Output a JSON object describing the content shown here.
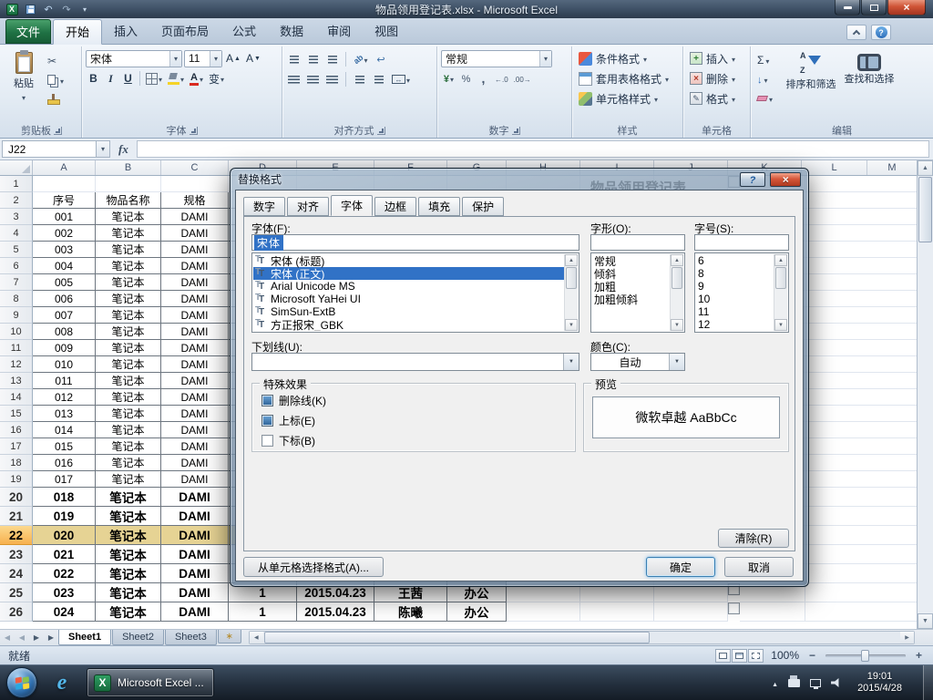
{
  "window": {
    "title": "物品领用登记表.xlsx - Microsoft Excel"
  },
  "ribbon": {
    "file_tab": "文件",
    "tabs": [
      {
        "label": "开始",
        "active": true
      },
      {
        "label": "插入"
      },
      {
        "label": "页面布局"
      },
      {
        "label": "公式"
      },
      {
        "label": "数据"
      },
      {
        "label": "审阅"
      },
      {
        "label": "视图"
      }
    ],
    "clipboard": {
      "label": "剪贴板",
      "paste": "粘贴"
    },
    "font": {
      "label": "字体",
      "name": "宋体",
      "size": "11",
      "bold": "B",
      "italic": "I",
      "underline": "U",
      "phonetic": "变"
    },
    "alignment": {
      "label": "对齐方式"
    },
    "number": {
      "label": "数字",
      "format": "常规"
    },
    "styles": {
      "label": "样式",
      "items": [
        "条件格式",
        "套用表格格式",
        "单元格样式"
      ]
    },
    "cells": {
      "label": "单元格",
      "items": [
        "插入",
        "删除",
        "格式"
      ]
    },
    "editing": {
      "label": "编辑",
      "sort": "排序和筛选",
      "find": "查找和选择"
    }
  },
  "formula_bar": {
    "name_box": "J22",
    "fx": "fx",
    "value": ""
  },
  "grid": {
    "title": "物品领用登记表",
    "columns": [
      "A",
      "B",
      "C",
      "D",
      "E",
      "F",
      "G",
      "H",
      "I",
      "J",
      "K",
      "L",
      "M"
    ],
    "rows": [
      {
        "num": "1",
        "plain": true
      },
      {
        "num": "2",
        "a": "序号",
        "b": "物品名称",
        "c": "规格"
      },
      {
        "num": "3",
        "a": "001",
        "b": "笔记本",
        "c": "DAMI"
      },
      {
        "num": "4",
        "a": "002",
        "b": "笔记本",
        "c": "DAMI"
      },
      {
        "num": "5",
        "a": "003",
        "b": "笔记本",
        "c": "DAMI"
      },
      {
        "num": "6",
        "a": "004",
        "b": "笔记本",
        "c": "DAMI"
      },
      {
        "num": "7",
        "a": "005",
        "b": "笔记本",
        "c": "DAMI"
      },
      {
        "num": "8",
        "a": "006",
        "b": "笔记本",
        "c": "DAMI"
      },
      {
        "num": "9",
        "a": "007",
        "b": "笔记本",
        "c": "DAMI"
      },
      {
        "num": "10",
        "a": "008",
        "b": "笔记本",
        "c": "DAMI"
      },
      {
        "num": "11",
        "a": "009",
        "b": "笔记本",
        "c": "DAMI"
      },
      {
        "num": "12",
        "a": "010",
        "b": "笔记本",
        "c": "DAMI"
      },
      {
        "num": "13",
        "a": "011",
        "b": "笔记本",
        "c": "DAMI"
      },
      {
        "num": "14",
        "a": "012",
        "b": "笔记本",
        "c": "DAMI"
      },
      {
        "num": "15",
        "a": "013",
        "b": "笔记本",
        "c": "DAMI"
      },
      {
        "num": "16",
        "a": "014",
        "b": "笔记本",
        "c": "DAMI"
      },
      {
        "num": "17",
        "a": "015",
        "b": "笔记本",
        "c": "DAMI"
      },
      {
        "num": "18",
        "a": "016",
        "b": "笔记本",
        "c": "DAMI"
      },
      {
        "num": "19",
        "a": "017",
        "b": "笔记本",
        "c": "DAMI"
      },
      {
        "num": "20",
        "a": "018",
        "b": "笔记本",
        "c": "DAMI",
        "bold": true
      },
      {
        "num": "21",
        "a": "019",
        "b": "笔记本",
        "c": "DAMI",
        "bold": true
      },
      {
        "num": "22",
        "a": "020",
        "b": "笔记本",
        "c": "DAMI",
        "bold": true,
        "hl": true
      },
      {
        "num": "23",
        "a": "021",
        "b": "笔记本",
        "c": "DAMI",
        "bold": true
      },
      {
        "num": "24",
        "a": "022",
        "b": "笔记本",
        "c": "DAMI",
        "bold": true
      },
      {
        "num": "25",
        "a": "023",
        "b": "笔记本",
        "c": "DAMI",
        "d": "1",
        "e": "2015.04.23",
        "f": "王茜",
        "g": "办公",
        "bold": true
      },
      {
        "num": "26",
        "a": "024",
        "b": "笔记本",
        "c": "DAMI",
        "d": "1",
        "e": "2015.04.23",
        "f": "陈曦",
        "g": "办公",
        "bold": true
      }
    ]
  },
  "sheet_bar": {
    "tabs": [
      {
        "label": "Sheet1",
        "active": true
      },
      {
        "label": "Sheet2"
      },
      {
        "label": "Sheet3"
      }
    ]
  },
  "status_bar": {
    "ready": "就绪",
    "zoom": "100%"
  },
  "taskbar": {
    "excel_button": "Microsoft Excel ...",
    "time": "19:01",
    "date": "2015/4/28"
  },
  "dialog": {
    "title": "替换格式",
    "tabs": [
      {
        "label": "数字"
      },
      {
        "label": "对齐"
      },
      {
        "label": "字体",
        "active": true
      },
      {
        "label": "边框"
      },
      {
        "label": "填充"
      },
      {
        "label": "保护"
      }
    ],
    "font": {
      "label": "字体(F):",
      "value": "宋体",
      "list": [
        {
          "name": "宋体 (标题)"
        },
        {
          "name": "宋体 (正文)",
          "selected": true
        },
        {
          "name": "Arial Unicode MS"
        },
        {
          "name": "Microsoft YaHei UI"
        },
        {
          "name": "SimSun-ExtB"
        },
        {
          "name": "方正报宋_GBK"
        }
      ]
    },
    "style": {
      "label": "字形(O):",
      "list": [
        {
          "name": "常规"
        },
        {
          "name": "倾斜"
        },
        {
          "name": "加粗"
        },
        {
          "name": "加粗倾斜"
        }
      ]
    },
    "size": {
      "label": "字号(S):",
      "list": [
        {
          "name": "6"
        },
        {
          "name": "8"
        },
        {
          "name": "9"
        },
        {
          "name": "10"
        },
        {
          "name": "11"
        },
        {
          "name": "12"
        }
      ]
    },
    "underline": {
      "label": "下划线(U):",
      "value": ""
    },
    "color": {
      "label": "颜色(C):",
      "value": "自动"
    },
    "effects": {
      "label": "特殊效果",
      "items": [
        {
          "label": "删除线(K)",
          "filled": true
        },
        {
          "label": "上标(E)",
          "filled": true
        },
        {
          "label": "下标(B)",
          "filled": false
        }
      ]
    },
    "preview": {
      "label": "预览",
      "text": "微软卓越  AaBbCc"
    },
    "buttons": {
      "clear": "清除(R)",
      "choose": "从单元格选择格式(A)...",
      "ok": "确定",
      "cancel": "取消"
    }
  },
  "colors": {
    "selection_blue": "#3172c6",
    "row_highlight": "#e6d394",
    "header_selected": "#f7b14f",
    "file_tab_green": "#1f7244"
  }
}
